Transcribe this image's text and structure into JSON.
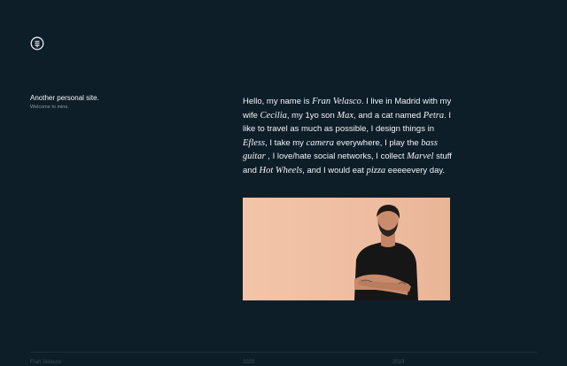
{
  "header": {
    "logo_icon": "efless-logo-icon"
  },
  "site": {
    "title": "Another personal site.",
    "subtitle": "Welcome to mine."
  },
  "bio": {
    "t1": "Hello, my name is ",
    "name": "Fran Velasco",
    "t2": ". I live in Madrid with my wife ",
    "wife": "Cecilia",
    "t3": ", my 1yo son ",
    "son": "Max",
    "t4": ", and a cat named ",
    "cat": "Petra",
    "t5": ". I like to travel as much as possible, I design things in ",
    "company": "Efless",
    "t6": ", I take my ",
    "camera": "camera",
    "t7": " everywhere, I play the ",
    "guitar": "bass guitar",
    "t8": " , I love/hate social networks, I collect ",
    "marvel": "Marvel",
    "t9": " stuff and ",
    "hotwheels": "Hot Wheels",
    "t10": ", and I would eat ",
    "pizza": "pizza",
    "t11": " eeeeevery day."
  },
  "photo": {
    "icon": "portrait-photo",
    "background": "#f0c0a4"
  },
  "footer": {
    "name": "Fran Velasco",
    "col_a": "2020",
    "col_b": "2019"
  },
  "colors": {
    "background": "#0e1e29",
    "text": "#f2f4f6",
    "muted": "#8a98a3"
  }
}
